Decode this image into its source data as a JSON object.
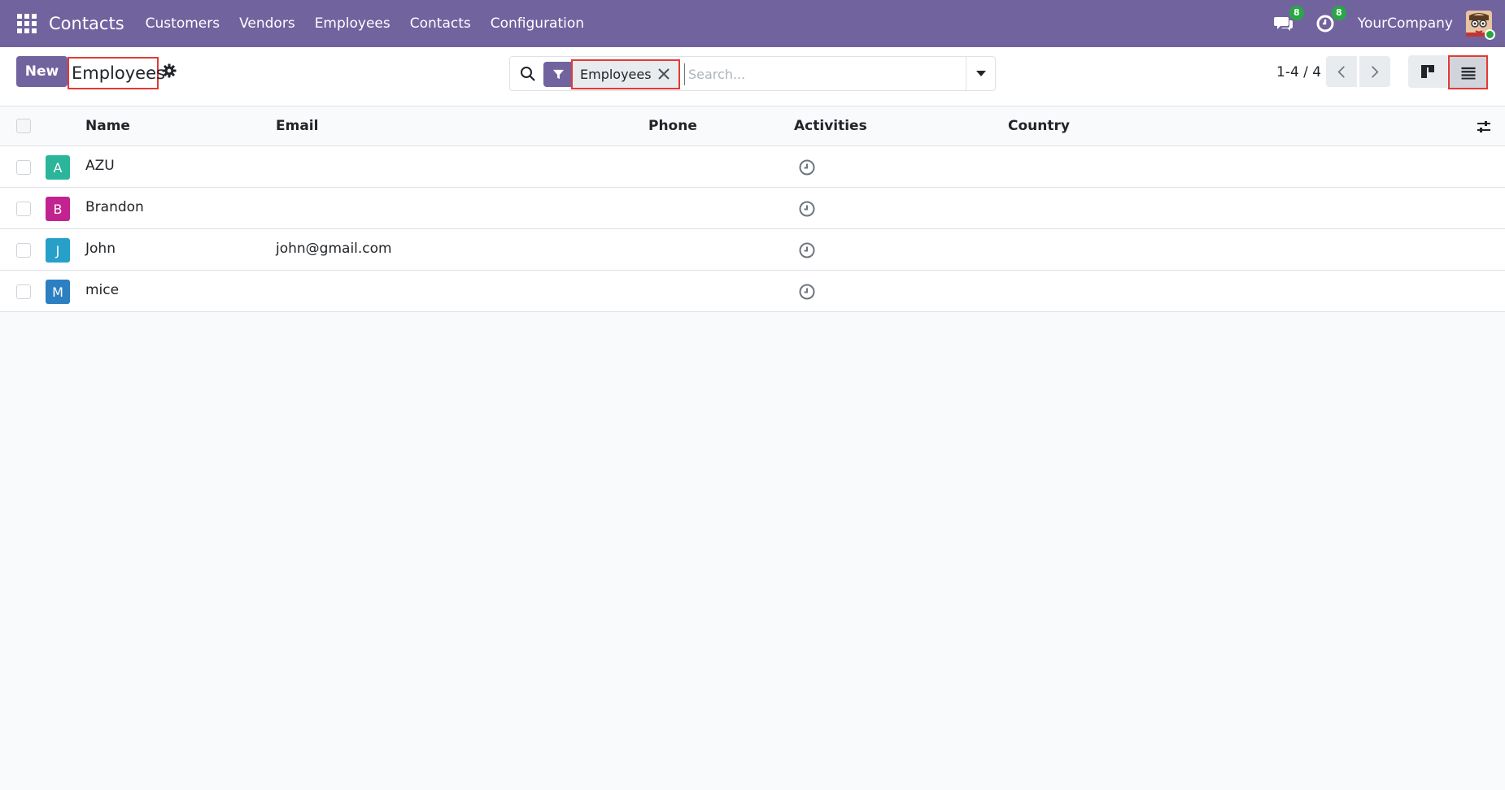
{
  "navbar": {
    "app_title": "Contacts",
    "menu": [
      "Customers",
      "Vendors",
      "Employees",
      "Contacts",
      "Configuration"
    ],
    "messages_badge": "8",
    "activities_badge": "8",
    "company": "YourCompany",
    "bg_color": "#71639e"
  },
  "control": {
    "new_label": "New",
    "title": "Employees",
    "search": {
      "facet": "Employees",
      "placeholder": "Search..."
    },
    "pager": "1-4 / 4"
  },
  "table": {
    "headers": {
      "name": "Name",
      "email": "Email",
      "phone": "Phone",
      "activities": "Activities",
      "country": "Country"
    },
    "rows": [
      {
        "initial": "A",
        "name": "AZU",
        "email": "",
        "phone": "",
        "country": "",
        "avatar_color": "#2bb59a"
      },
      {
        "initial": "B",
        "name": "Brandon",
        "email": "",
        "phone": "",
        "country": "",
        "avatar_color": "#c22390"
      },
      {
        "initial": "J",
        "name": "John",
        "email": "john@gmail.com",
        "phone": "",
        "country": "",
        "avatar_color": "#27a0c9"
      },
      {
        "initial": "M",
        "name": "mice",
        "email": "",
        "phone": "",
        "country": "",
        "avatar_color": "#2c7fc0"
      }
    ]
  },
  "icons": {
    "apps": "apps-grid-icon",
    "messages": "chat-icon",
    "activities": "clock-icon",
    "settings": "gear-icon",
    "search": "search-icon",
    "filter": "funnel-icon",
    "remove": "close-icon",
    "dropdown": "caret-down-icon",
    "prev": "chevron-left-icon",
    "next": "chevron-right-icon",
    "kanban": "kanban-view-icon",
    "list": "list-view-icon",
    "optional_columns": "sliders-icon"
  }
}
